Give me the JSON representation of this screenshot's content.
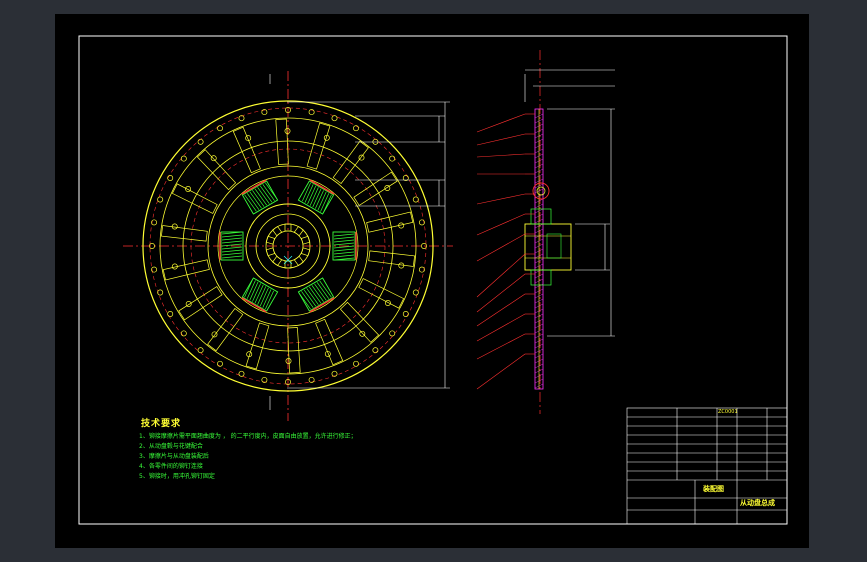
{
  "drawing": {
    "tech_title": "技术要求",
    "tech_lines": [
      "1、铆接摩擦片需平面翘曲度为 ， 的二平行度内，皮面自由放置，允许进行修正；",
      "2、从动盘毂与花键配合",
      "3、摩擦片与从动盘装配后",
      "4、各零件间的铆钉连接",
      "5、铆接时，用冲孔铆钉固定"
    ],
    "title_block": {
      "assembly_name": "从动盘总成",
      "drawing_type": "装配图",
      "drawing_no": "ZC0001"
    }
  },
  "colors": {
    "frame": "#ffffff",
    "outline": "#ffff33",
    "green": "#39ff3a",
    "red": "#ff3030",
    "cyan": "#33ffff",
    "magenta": "#ff33ff"
  }
}
